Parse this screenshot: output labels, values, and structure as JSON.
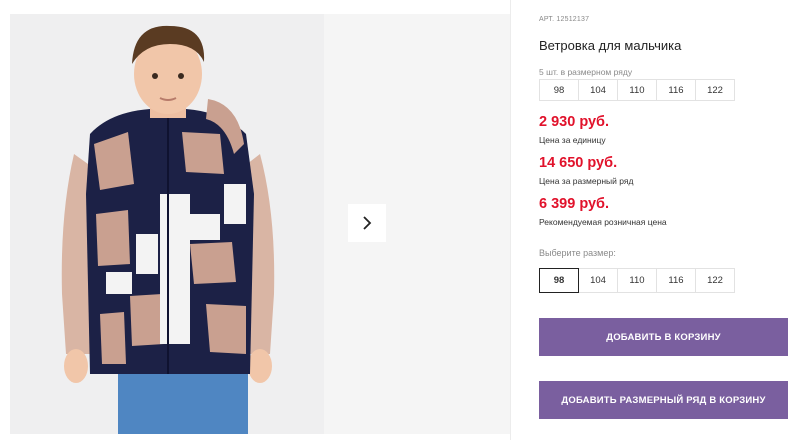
{
  "product": {
    "sku": "АРТ. 12512137",
    "title": "Ветровка для мальчика",
    "image_alt": "boy-in-printed-jacket"
  },
  "pack": {
    "label": "5 шт. в размерном ряду",
    "sizes": [
      "98",
      "104",
      "110",
      "116",
      "122"
    ]
  },
  "prices": {
    "unit_price": "2 930 руб.",
    "unit_label": "Цена за единицу",
    "pack_price": "14 650 руб.",
    "pack_label": "Цена за размерный ряд",
    "retail_price": "6 399 руб.",
    "retail_label": "Рекомендуемая розничная цена"
  },
  "size_select": {
    "label": "Выберите размер:",
    "options": [
      "98",
      "104",
      "110",
      "116",
      "122"
    ],
    "selected": "98"
  },
  "actions": {
    "add_to_cart": "ДОБАВИТЬ В КОРЗИНУ",
    "add_pack_to_cart": "ДОБАВИТЬ РАЗМЕРНЫЙ РЯД В КОРЗИНУ"
  },
  "colors": {
    "price": "#e1122b",
    "button": "#7a5f9f",
    "jacket_navy": "#1c2146",
    "jacket_pink": "#c9a090"
  }
}
